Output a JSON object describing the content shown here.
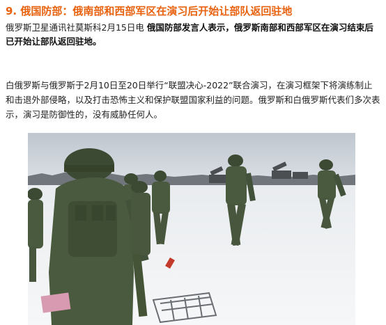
{
  "article": {
    "heading": "9. 俄国防部：俄南部和西部军区在演习后开始让部队返回驻地",
    "para1_prefix": "俄罗斯卫星通讯社莫斯科2月15日电 ",
    "para1_bold": "俄国防部发言人表示，俄罗斯南部和西部军区在演习结束后已开始让部队返回驻地。",
    "para2": "白俄罗斯与俄罗斯于2月10日至20日举行“联盟决心-2022”联合演习，在演习框架下将演练制止和击退外部侵略，以及打击恐怖主义和保护联盟国家利益的问题。俄罗斯和白俄罗斯代表们多次表示，演习是防御性的，没有威胁任何人。"
  },
  "photo": {
    "subject": "soldiers-in-snow-field",
    "colors": {
      "sky": "#c9cfd6",
      "snow": "#eef0f3",
      "uniform": "#4a5a3f",
      "helmet": "#3d4a33",
      "treeline": "#5a5f63"
    }
  }
}
